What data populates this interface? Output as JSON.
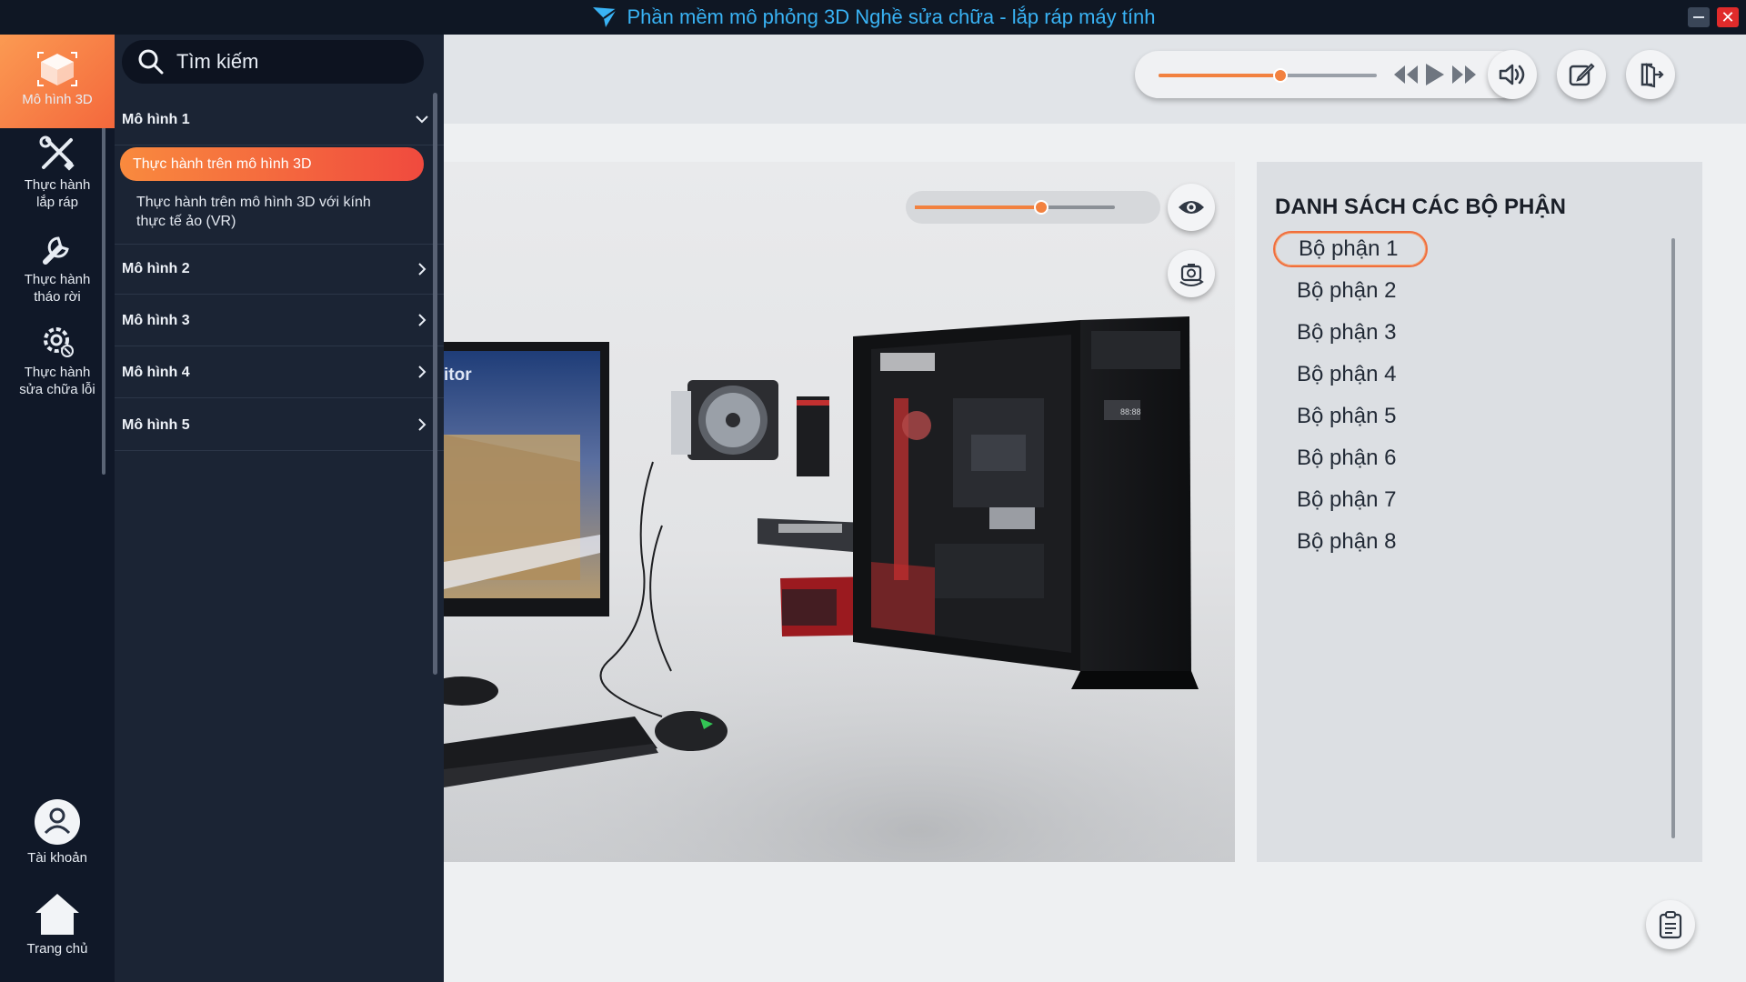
{
  "window": {
    "title": "Phần mềm mô phỏng 3D Nghề sửa chữa - lắp ráp máy tính",
    "minimize_label": "—",
    "close_label": "✕"
  },
  "rail": {
    "items": [
      {
        "label": "Mô hình 3D",
        "icon": "cube-icon",
        "active": true
      },
      {
        "label_line1": "Thực hành",
        "label_line2": "lắp ráp",
        "icon": "tools-icon"
      },
      {
        "label_line1": "Thực hành",
        "label_line2": "tháo rời",
        "icon": "wrench-icon"
      },
      {
        "label_line1": "Thực hành",
        "label_line2": "sửa chữa lỗi",
        "icon": "gear-icon"
      }
    ],
    "account_label": "Tài khoản",
    "home_label": "Trang chủ"
  },
  "menu": {
    "search_placeholder": "Tìm kiếm",
    "groups": [
      {
        "label": "Mô hình 1",
        "expanded": true
      },
      {
        "label": "Mô hình 2"
      },
      {
        "label": "Mô hình 3"
      },
      {
        "label": "Mô hình 4"
      },
      {
        "label": "Mô hình 5"
      }
    ],
    "subitems": [
      {
        "label": "Thực hành trên mô hình 3D",
        "active": true
      },
      {
        "label_line1": "Thực hành trên mô hình 3D với kính",
        "label_line2": "thực tế ảo (VR)"
      }
    ]
  },
  "player": {
    "progress": 0.56
  },
  "viewport": {
    "opacity_level": 0.63,
    "monitor_text": "itor"
  },
  "parts": {
    "title": "DANH SÁCH CÁC BỘ PHẬN",
    "items": [
      "Bộ phận 1",
      "Bộ phận 2",
      "Bộ phận 3",
      "Bộ phận 4",
      "Bộ phận 5",
      "Bộ phận 6",
      "Bộ phận 7",
      "Bộ phận 8"
    ],
    "selected_index": 0
  },
  "colors": {
    "accent": "#f2813f",
    "accent_red": "#f04a3e",
    "title_blue": "#39b3f5",
    "rail_bg": "#101828",
    "menu_bg": "#1b2434"
  }
}
